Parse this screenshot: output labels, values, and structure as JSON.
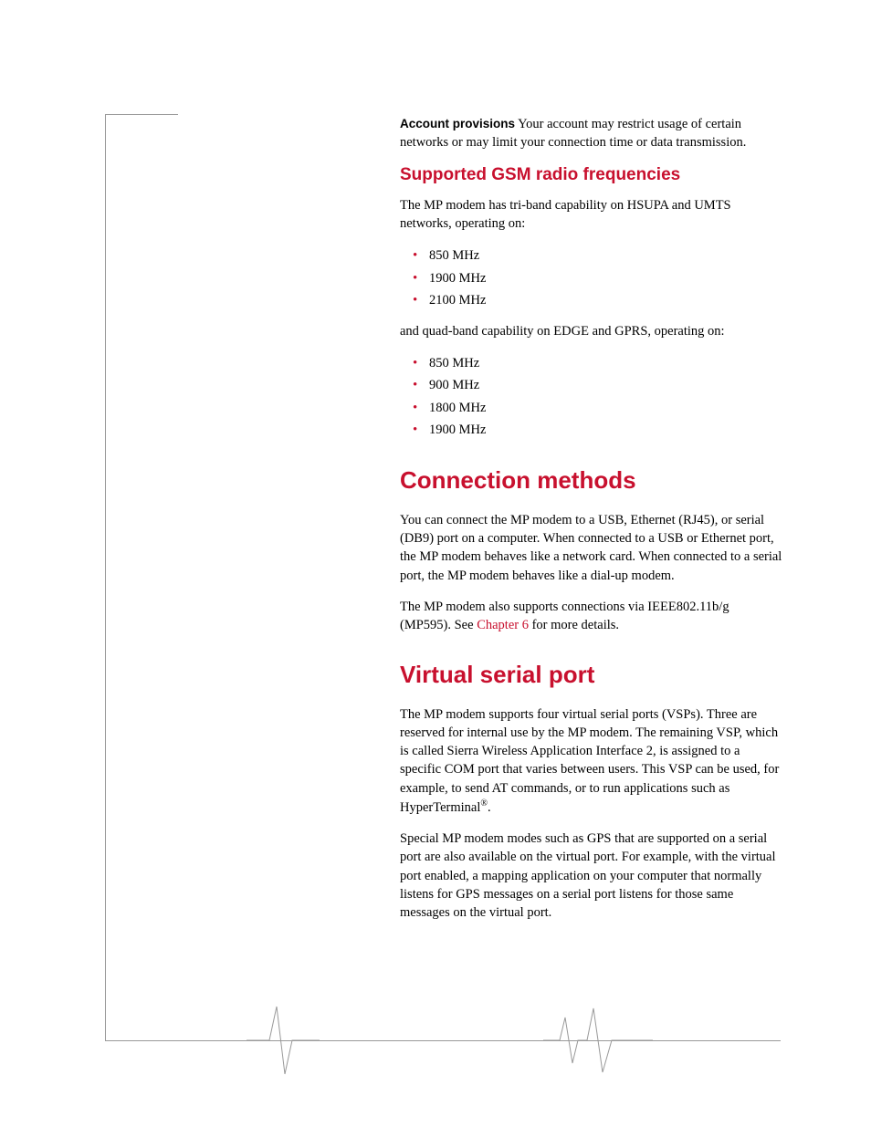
{
  "intro": {
    "lead": "Account provisions",
    "text": "   Your account may restrict usage of certain networks or may limit your connection time or data transmission."
  },
  "section1": {
    "heading": "Supported GSM radio frequencies",
    "p1": "The MP modem has tri-band capability on HSUPA and UMTS networks, operating on:",
    "list1": [
      "850 MHz",
      "1900 MHz",
      "2100 MHz"
    ],
    "p2": "and quad-band capability on EDGE and GPRS, operating on:",
    "list2": [
      "850 MHz",
      "900 MHz",
      "1800 MHz",
      "1900 MHz"
    ]
  },
  "section2": {
    "heading": "Connection methods",
    "p1": "You can connect the MP modem to a USB, Ethernet (RJ45), or serial (DB9) port on a computer. When connected to a USB or Ethernet port, the MP modem behaves like a network card. When connected to a serial port, the MP modem behaves like a dial-up modem.",
    "p2a": "The MP modem also supports connections via IEEE802.11b/g (MP595). See ",
    "p2link": "Chapter 6",
    "p2b": " for more details."
  },
  "section3": {
    "heading": "Virtual serial port",
    "p1a": "The MP modem supports four virtual serial ports (VSPs). Three are reserved for internal use by the MP modem. The remaining VSP, which is called Sierra Wireless Application Interface 2, is assigned to a specific COM port that varies between users. This VSP can be used, for example, to send AT commands, or to run applications such as HyperTerminal",
    "p1sup": "®",
    "p1b": ".",
    "p2": "Special MP modem modes such as GPS that are supported on a serial port are also available on the virtual port. For example, with the virtual port enabled, a mapping application on your computer that normally listens for GPS messages on a serial port listens for those same messages on the virtual port."
  }
}
